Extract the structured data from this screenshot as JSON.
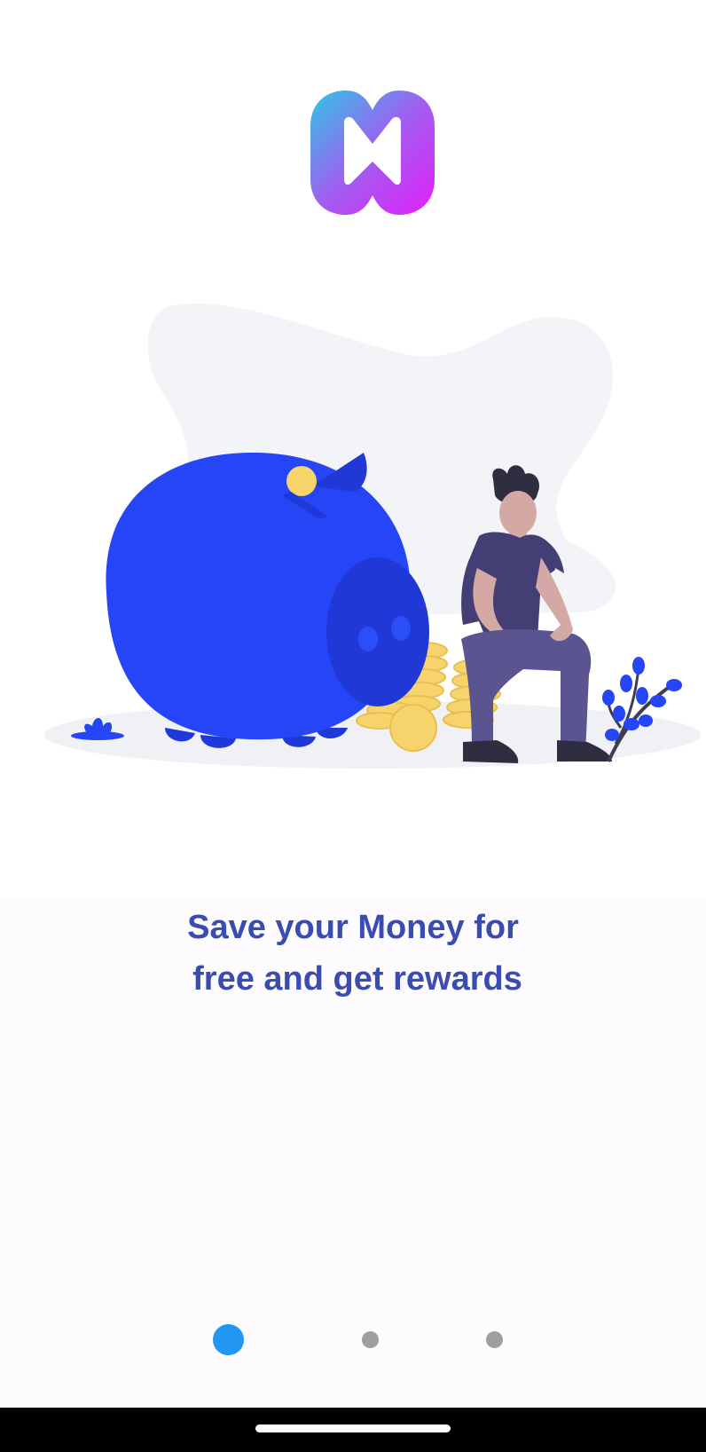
{
  "app": {
    "logo_icon": "app-logo-icon",
    "logo_gradient": [
      "#2fc6e4",
      "#a15ef0",
      "#e020f8"
    ]
  },
  "illustration": {
    "icon": "piggy-bank-savings-illustration",
    "colors": {
      "pig": "#2545f6",
      "snout": "#2039d6",
      "coin": "#f7d36b",
      "blob": "#f3f4f7",
      "shirt": "#433f74",
      "pants": "#5a5491",
      "skin": "#d4a8a4"
    }
  },
  "onboarding": {
    "headline_line_1": "Save your Money for",
    "headline_line_2": "free and get rewards",
    "headline_color": "#3a4cb0"
  },
  "pager": {
    "current_page": 1,
    "page_count": 3,
    "active_color": "#2196f3",
    "inactive_color": "#9e9e9e"
  }
}
